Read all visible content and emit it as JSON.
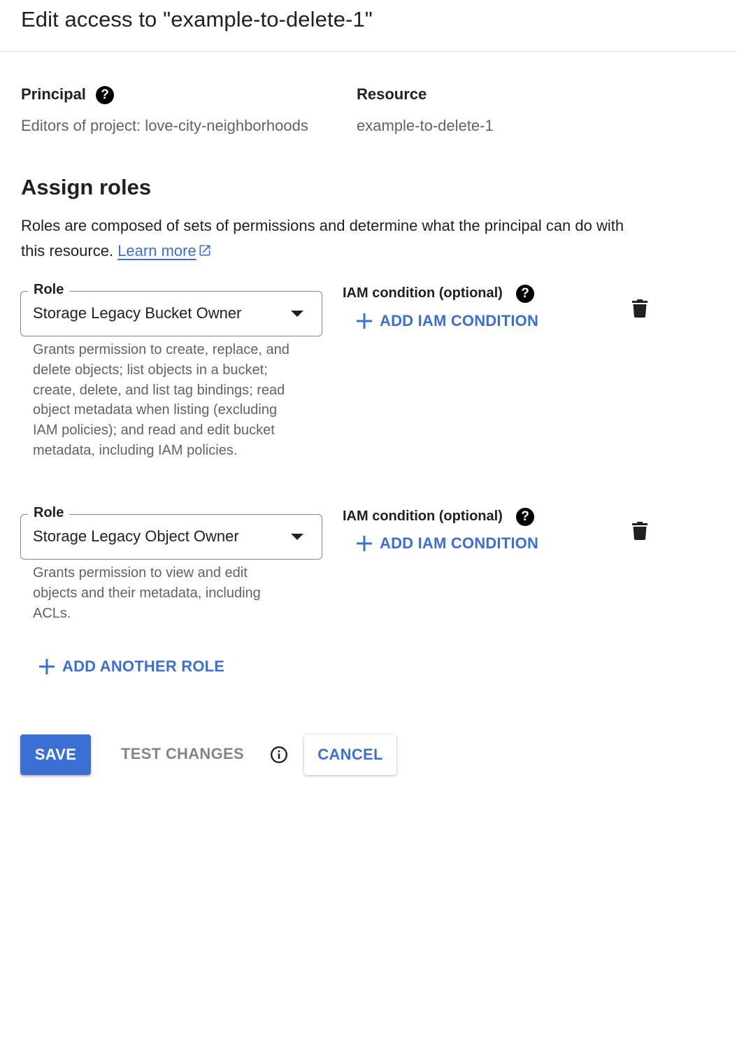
{
  "header": {
    "title": "Edit access to \"example-to-delete-1\""
  },
  "principal": {
    "label": "Principal",
    "help_icon": "help-circle-icon",
    "value": "Editors of project: love-city-neighborhoods"
  },
  "resource": {
    "label": "Resource",
    "value": "example-to-delete-1"
  },
  "assign_roles": {
    "title": "Assign roles",
    "description": "Roles are composed of sets of permissions and determine what the principal can do with this resource.",
    "learn_more": "Learn more",
    "learn_more_icon": "external-link-icon"
  },
  "roles": [
    {
      "field_label": "Role",
      "value": "Storage Legacy Bucket Owner",
      "description": "Grants permission to create, replace, and delete objects; list objects in a bucket; create, delete, and list tag bindings; read object metadata when listing (excluding IAM policies); and read and edit bucket metadata, including IAM policies.",
      "condition_label": "IAM condition (optional)",
      "add_condition": "ADD IAM CONDITION",
      "delete_icon": "trash-icon"
    },
    {
      "field_label": "Role",
      "value": "Storage Legacy Object Owner",
      "description": "Grants permission to view and edit objects and their metadata, including ACLs.",
      "condition_label": "IAM condition (optional)",
      "add_condition": "ADD IAM CONDITION",
      "delete_icon": "trash-icon"
    }
  ],
  "add_another_role": "ADD ANOTHER ROLE",
  "actions": {
    "save": "SAVE",
    "test_changes": "TEST CHANGES",
    "cancel": "CANCEL"
  },
  "colors": {
    "accent": "#3b6fd4",
    "secondary_text": "#5f6368",
    "disabled": "#80868b"
  }
}
